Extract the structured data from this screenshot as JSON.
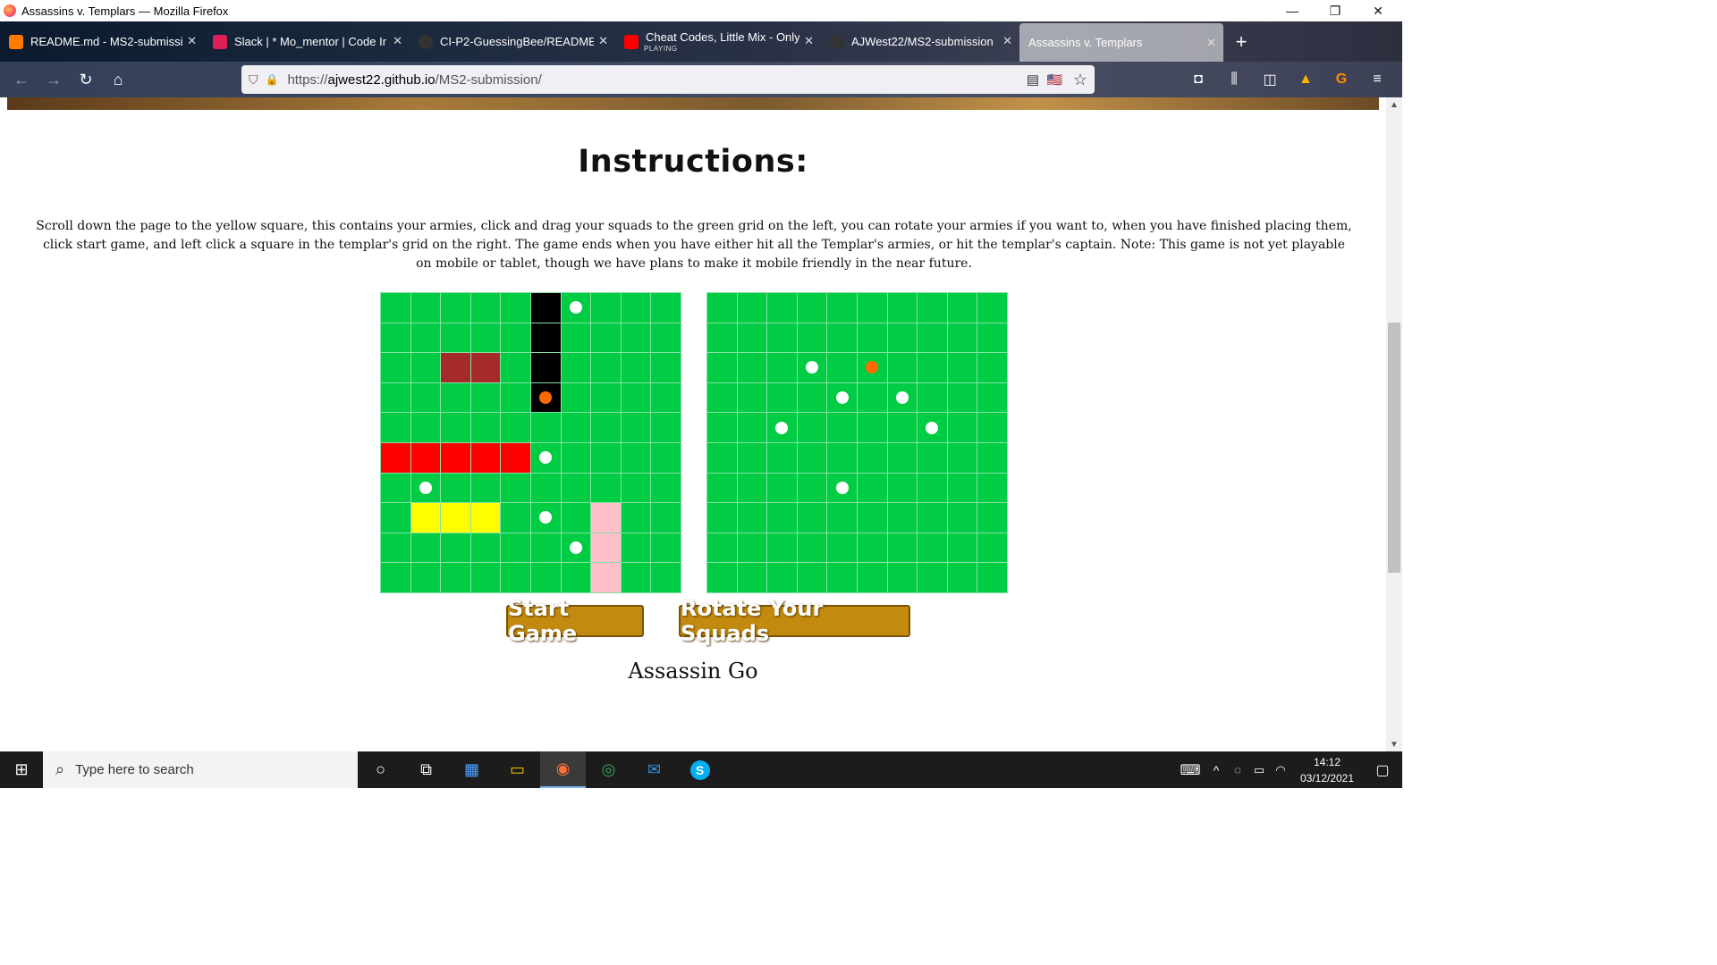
{
  "window": {
    "title": "Assassins v. Templars — Mozilla Firefox",
    "minimize": "—",
    "restore": "❐",
    "close": "✕"
  },
  "tabs": [
    {
      "label": "README.md - MS2-submission",
      "icon_color": "#ff7a00",
      "close": "✕"
    },
    {
      "label": "Slack | * Mo_mentor | Code Insti",
      "icon_color": "#e01e5a",
      "close": "✕"
    },
    {
      "label": "CI-P2-GuessingBee/README.m",
      "icon_color": "#333333",
      "close": "✕"
    },
    {
      "label": "Cheat Codes, Little Mix - Only Y",
      "sub": "PLAYING",
      "icon_color": "#ff0000",
      "close": "✕"
    },
    {
      "label": "AJWest22/MS2-submission",
      "icon_color": "#333333",
      "close": "✕"
    },
    {
      "label": "Assassins v. Templars",
      "icon_color": "transparent",
      "close": "✕",
      "active": true
    }
  ],
  "new_tab": "+",
  "nav": {
    "back": "←",
    "forward": "→",
    "reload": "↻",
    "home": "⌂",
    "url_prefix": "https://",
    "url_host": "ajwest22.github.io",
    "url_path": "/MS2-submission/",
    "shield": "⛉",
    "lock": "🔒",
    "reader": "▤",
    "flag": "🇺🇸",
    "star": "☆",
    "pocket": "◘",
    "library": "⫼",
    "sidebar": "◫",
    "ext1": "▲",
    "ext2": "G",
    "menu": "≡"
  },
  "page": {
    "title": "Instructions:",
    "instructions": "Scroll down the page to the yellow square, this contains your armies, click and drag your squads to the green grid on the left, you can rotate your armies if you want to, when you have finished placing them, click start game, and left click a square in the templar's grid on the right. The game ends when you have either hit all the Templar's armies, or hit the templar's captain. Note: This game is not yet playable on mobile or tablet, though we have plans to make it mobile friendly in the near future.",
    "start_button": "Start Game",
    "rotate_button": "Rotate Your Squads",
    "turn_text": "Assassin Go"
  },
  "colors": {
    "grid_green": "#00cc44",
    "miss": "#ffffff",
    "hit": "#ff6a00",
    "button_gold": "#c28a0e"
  },
  "assassin_grid": {
    "cells": {
      "5": "#000000",
      "15": "#000000",
      "25": "#000000",
      "35": "#000000",
      "22": "#a52a2a",
      "23": "#a52a2a",
      "50": "#ff0000",
      "51": "#ff0000",
      "52": "#ff0000",
      "53": "#ff0000",
      "54": "#ff0000",
      "71": "#ffff00",
      "72": "#ffff00",
      "73": "#ffff00",
      "77": "#ffc0cb",
      "87": "#ffc0cb",
      "97": "#ffc0cb"
    },
    "misses": [
      6,
      55,
      61,
      75,
      86
    ],
    "hits": [
      35
    ]
  },
  "templar_grid": {
    "cells": {},
    "misses": [
      23,
      34,
      36,
      42,
      47,
      64
    ],
    "hits": [
      25
    ]
  },
  "taskbar": {
    "start": "⊞",
    "search_icon": "⌕",
    "search_placeholder": "Type here to search",
    "cortana": "○",
    "taskview": "⧉",
    "store": "▦",
    "explorer": "▭",
    "firefox": "◉",
    "chrome": "◎",
    "mail": "✉",
    "skype": "S",
    "keyboard": "⌨",
    "chevron": "^",
    "network": "◌",
    "battery": "▭",
    "wifi": "◠",
    "time": "14:12",
    "date": "03/12/2021",
    "notifications": "▢"
  }
}
